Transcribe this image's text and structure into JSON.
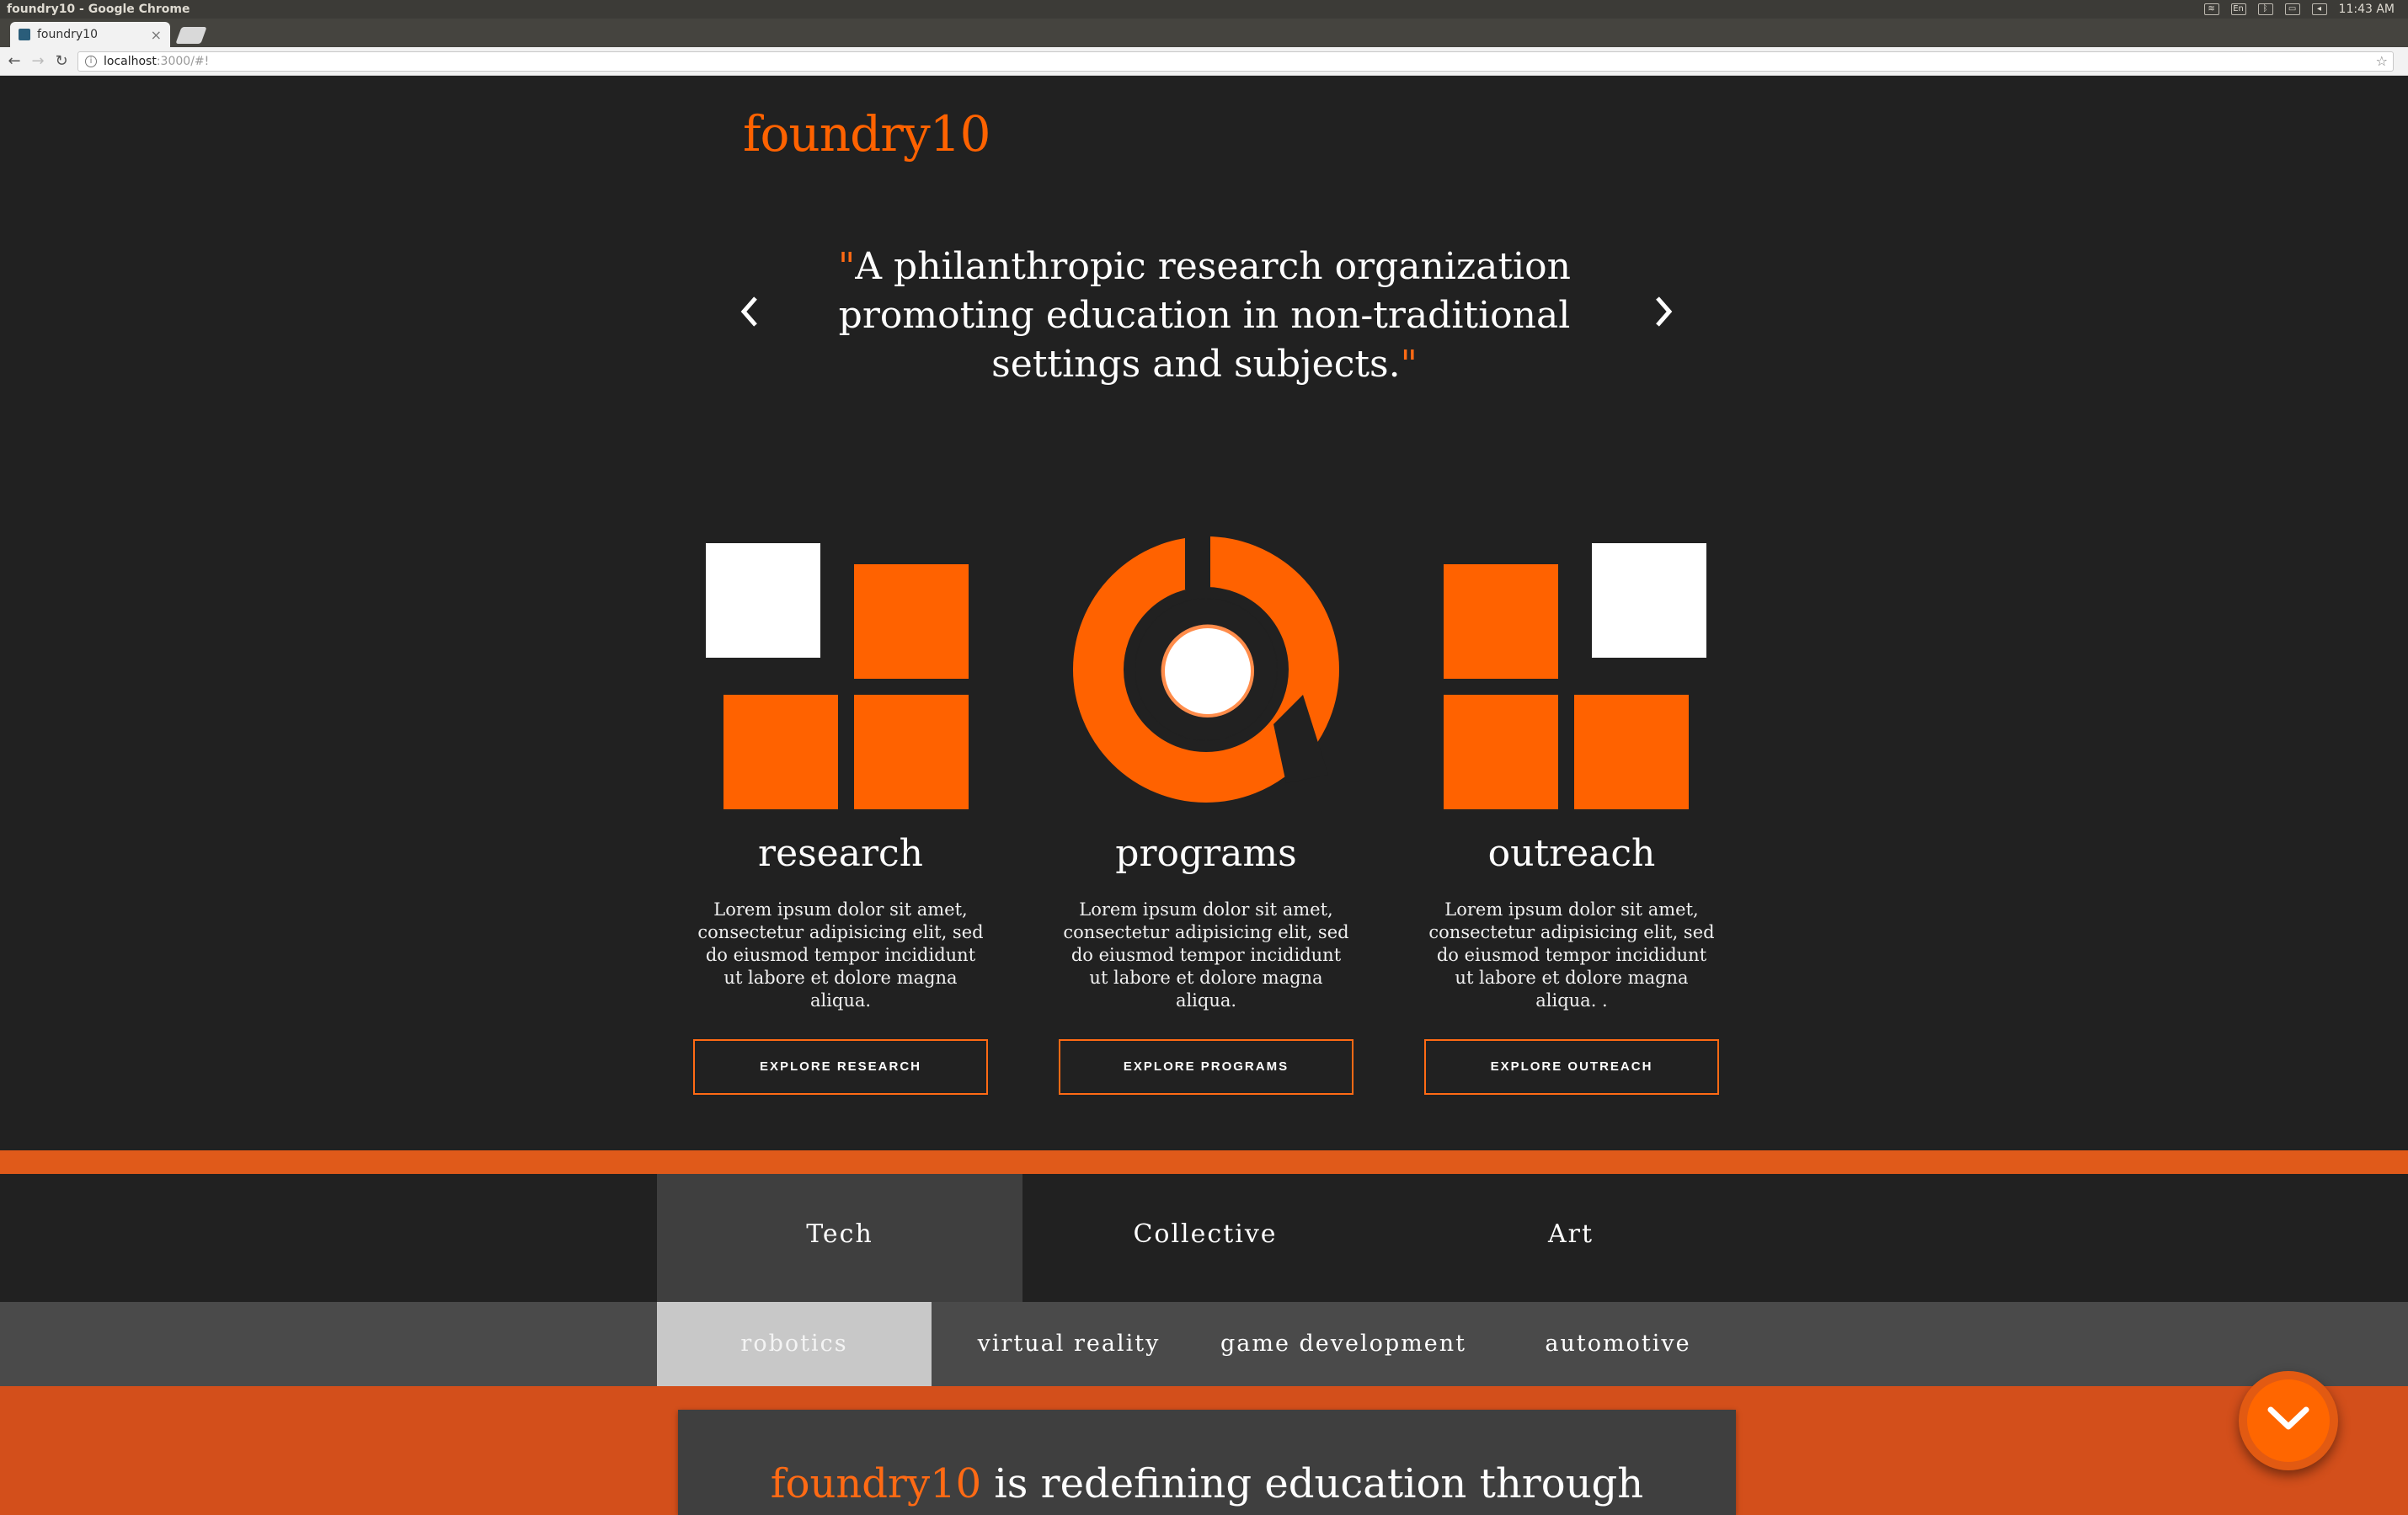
{
  "window": {
    "title": "foundry10 - Google Chrome",
    "clock": "11:43 AM",
    "keyboard_layout": "En"
  },
  "browser": {
    "tab_title": "foundry10",
    "url_host": "localhost",
    "url_path": ":3000/#!"
  },
  "header": {
    "logo": "foundry10"
  },
  "hero": {
    "open_quote": "\"",
    "quote": "A philanthropic research organization promoting education in non-traditional settings and subjects.",
    "close_quote": "\"",
    "prev_icon": "chevron-left-icon",
    "next_icon": "chevron-right-icon"
  },
  "columns": [
    {
      "title": "research",
      "text": "Lorem ipsum dolor sit amet, consectetur adipisicing elit, sed do eiusmod tempor incididunt ut labore et dolore magna aliqua.",
      "button": "EXPLORE RESEARCH"
    },
    {
      "title": "programs",
      "text": "Lorem ipsum dolor sit amet, consectetur adipisicing elit, sed do eiusmod tempor incididunt ut labore et dolore magna aliqua.",
      "button": "EXPLORE PROGRAMS"
    },
    {
      "title": "outreach",
      "text": "Lorem ipsum dolor sit amet, consectetur adipisicing elit, sed do eiusmod tempor incididunt ut labore et dolore magna aliqua. .",
      "button": "EXPLORE OUTREACH"
    }
  ],
  "category_tabs": [
    {
      "label": "Tech",
      "active": true
    },
    {
      "label": "Collective",
      "active": false
    },
    {
      "label": "Art",
      "active": false
    }
  ],
  "sub_tabs": [
    {
      "label": "robotics",
      "active": true
    },
    {
      "label": "virtual reality",
      "active": false
    },
    {
      "label": "game development",
      "active": false
    },
    {
      "label": "automotive",
      "active": false
    }
  ],
  "card": {
    "brand": "foundry10",
    "text": " is redefining education through"
  },
  "fab": {
    "icon": "chevron-down-icon"
  },
  "colors": {
    "accent": "#ff6200",
    "background": "#212121",
    "band": "#e05a1a",
    "tab_active": "#3f3f3f",
    "subtab_active": "#c8c8c8"
  }
}
